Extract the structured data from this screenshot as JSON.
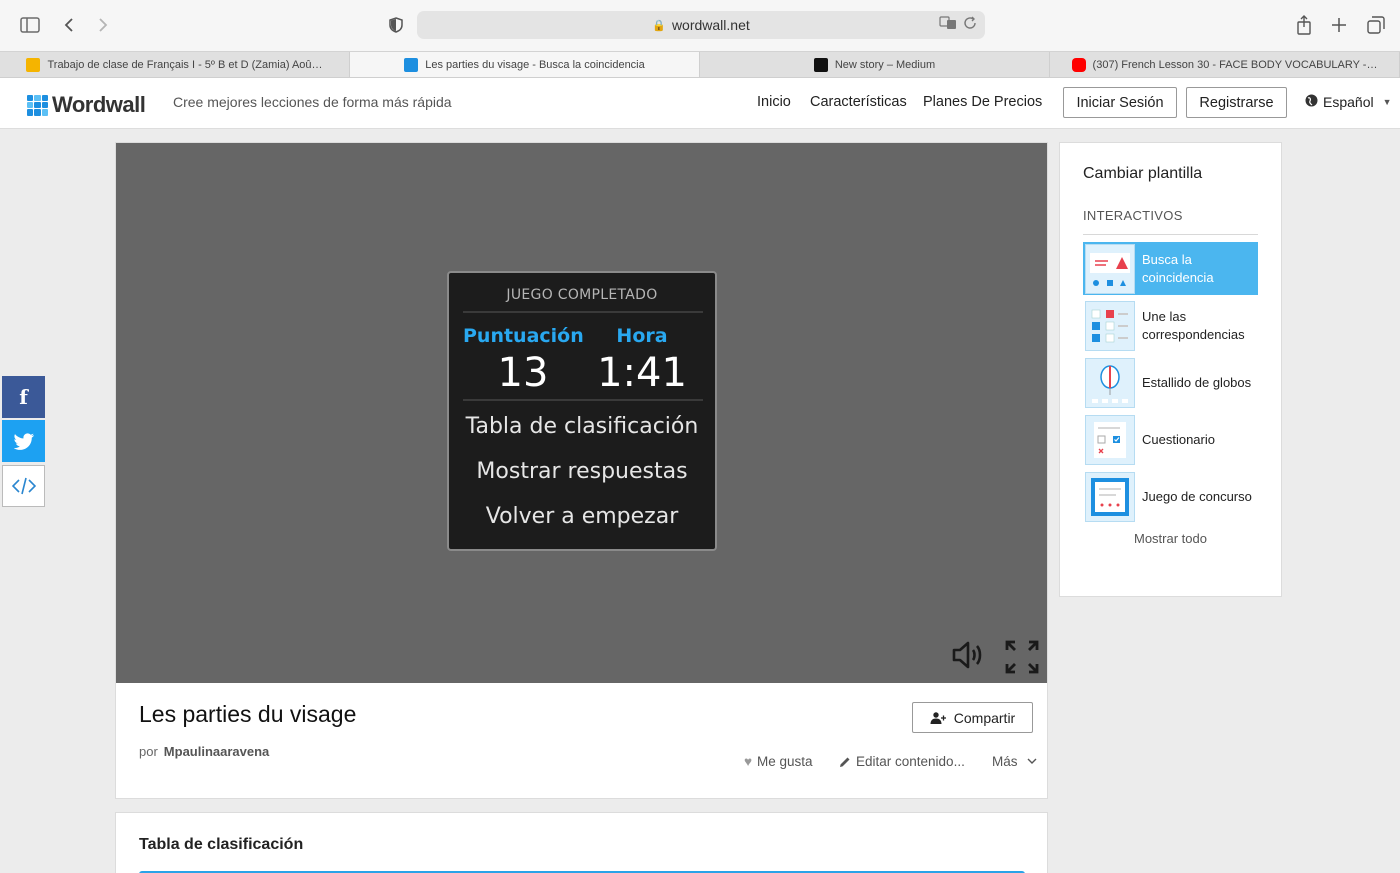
{
  "browser": {
    "url": "wordwall.net",
    "tabs": [
      {
        "title": "Trabajo de clase de Français I - 5º B et D (Zamia) Aoû…",
        "favicon_color": "#f5b400"
      },
      {
        "title": "Les parties du visage - Busca la coincidencia",
        "favicon_color": "#1d8fe0"
      },
      {
        "title": "New story – Medium",
        "favicon_color": "#111111"
      },
      {
        "title": "(307) French Lesson 30 - FACE BODY VOCABULARY -…",
        "favicon_color": "#ff0000"
      }
    ]
  },
  "site": {
    "logo": "Wordwall",
    "tagline": "Cree mejores lecciones de forma más rápida",
    "nav": {
      "home": "Inicio",
      "features": "Características",
      "pricing": "Planes De Precios"
    },
    "login": "Iniciar Sesión",
    "signup": "Registrarse",
    "language": "Español"
  },
  "game": {
    "header": "JUEGO COMPLETADO",
    "score_label": "Puntuación",
    "score": "13",
    "time_label": "Hora",
    "time": "1:41",
    "options": [
      "Tabla de clasificación",
      "Mostrar respuestas",
      "Volver a empezar"
    ]
  },
  "activity": {
    "title": "Les parties du visage",
    "by": "por",
    "author": "Mpaulinaaravena",
    "share": "Compartir",
    "like": "Me gusta",
    "edit": "Editar contenido...",
    "more": "Más"
  },
  "leaderboard": {
    "title": "Tabla de clasificación"
  },
  "sidebar": {
    "title": "Cambiar plantilla",
    "section": "INTERACTIVOS",
    "templates": [
      {
        "label": "Busca la coincidencia",
        "active": true
      },
      {
        "label": "Une las correspondencias",
        "active": false
      },
      {
        "label": "Estallido de globos",
        "active": false
      },
      {
        "label": "Cuestionario",
        "active": false
      },
      {
        "label": "Juego de concurso",
        "active": false
      }
    ],
    "show_all": "Mostrar todo"
  },
  "colors": {
    "accent": "#2aa3e8",
    "facebook": "#3b5998",
    "twitter": "#1da1f2"
  }
}
